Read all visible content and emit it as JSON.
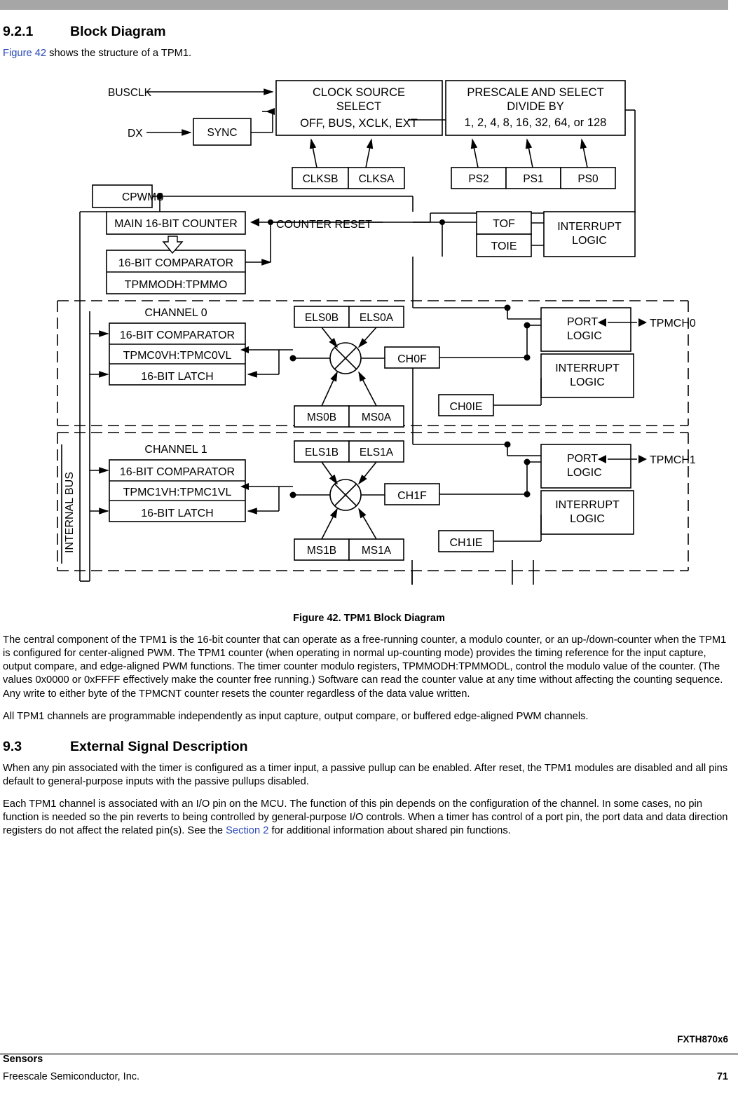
{
  "section": {
    "number": "9.2.1",
    "title": "Block Diagram"
  },
  "intro": {
    "xref": "Figure 42",
    "rest": " shows the structure of a TPM1."
  },
  "figure": {
    "caption": "Figure 42. TPM1 Block Diagram",
    "labels": {
      "busclk": "BUSCLK",
      "dx": "DX",
      "sync": "SYNC",
      "clock_source_1": "CLOCK SOURCE",
      "clock_source_2": "SELECT",
      "clock_source_3": "OFF, BUS, XCLK, EXT",
      "prescale_1": "PRESCALE AND SELECT",
      "prescale_2": "DIVIDE BY",
      "prescale_3": "1, 2, 4, 8, 16, 32, 64, or 128",
      "clksb": "CLKSB",
      "clksa": "CLKSA",
      "ps2": "PS2",
      "ps1": "PS1",
      "ps0": "PS0",
      "cpwms": "CPWMS",
      "main_counter": "MAIN 16-BIT COUNTER",
      "counter_reset": "COUNTER RESET",
      "comparator_main": "16-BIT COMPARATOR",
      "tpmmod": "TPMMODH:TPMMO",
      "tof": "TOF",
      "toie": "TOIE",
      "interrupt_logic_top_1": "INTERRUPT",
      "interrupt_logic_top_2": "LOGIC",
      "internal_bus": "INTERNAL BUS",
      "channel0": "CHANNEL 0",
      "ch0_comparator": "16-BIT COMPARATOR",
      "ch0_reg": "TPMC0VH:TPMC0VL",
      "ch0_latch": "16-BIT LATCH",
      "els0b": "ELS0B",
      "els0a": "ELS0A",
      "ms0b": "MS0B",
      "ms0a": "MS0A",
      "ch0f": "CH0F",
      "ch0ie": "CH0IE",
      "port_logic0_1": "PORT",
      "port_logic0_2": "LOGIC",
      "interrupt_logic0_1": "INTERRUPT",
      "interrupt_logic0_2": "LOGIC",
      "tpmch0": "TPMCH0",
      "channel1": "CHANNEL 1",
      "ch1_comparator": "16-BIT COMPARATOR",
      "ch1_reg": "TPMC1VH:TPMC1VL",
      "ch1_latch": "16-BIT LATCH",
      "els1b": "ELS1B",
      "els1a": "ELS1A",
      "ms1b": "MS1B",
      "ms1a": "MS1A",
      "ch1f": "CH1F",
      "ch1ie": "CH1IE",
      "port_logic1_1": "PORT",
      "port_logic1_2": "LOGIC",
      "interrupt_logic1_1": "INTERRUPT",
      "interrupt_logic1_2": "LOGIC",
      "tpmch1": "TPMCH1"
    }
  },
  "paragraphs": {
    "p1": "The central component of the TPM1 is the 16-bit counter that can operate as a free-running counter, a modulo counter, or an up-/down-counter when the TPM1 is configured for center-aligned PWM. The TPM1 counter (when operating in normal up-counting mode) provides the timing reference for the input capture, output compare, and edge-aligned PWM functions. The timer counter modulo registers, TPMMODH:TPMMODL, control the modulo value of the counter. (The values 0x0000 or 0xFFFF effectively make the counter free running.) Software can read the counter value at any time without affecting the counting sequence. Any write to either byte of the TPMCNT counter resets the counter regardless of the data value written.",
    "p2": "All TPM1 channels are programmable independently as input capture, output compare, or buffered edge-aligned PWM channels."
  },
  "section2": {
    "number": "9.3",
    "title": "External Signal Description"
  },
  "paragraphs2": {
    "p1": "When any pin associated with the timer is configured as a timer input, a passive pullup can be enabled. After reset, the TPM1 modules are disabled and all pins default to general-purpose inputs with the passive pullups disabled.",
    "p2_a": "Each TPM1 channel is associated with an I/O pin on the MCU. The function of this pin depends on the configuration of the channel. In some cases, no pin function is needed so the pin reverts to being controlled by general-purpose I/O controls. When a timer has control of a port pin, the port data and data direction registers do not affect the related pin(s). See the ",
    "p2_xref": "Section 2",
    "p2_b": " for additional information about shared pin functions."
  },
  "footer": {
    "doc": "FXTH870x6",
    "sensors": "Sensors",
    "company": "Freescale Semiconductor, Inc.",
    "page": "71"
  }
}
